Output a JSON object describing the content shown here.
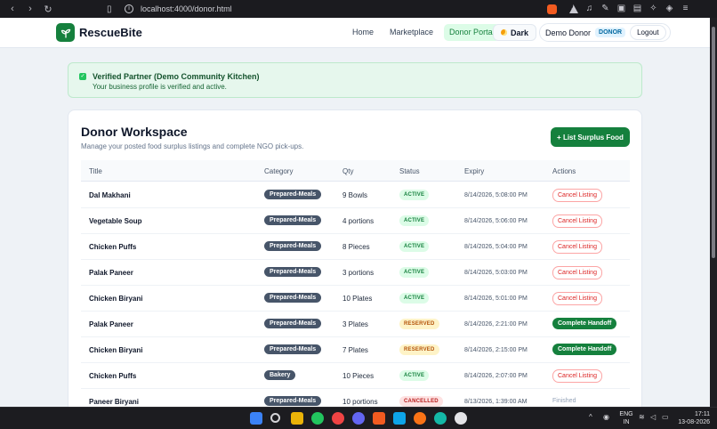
{
  "browser": {
    "url": "localhost:4000/donor.html"
  },
  "header": {
    "brand": "RescueBite",
    "nav": [
      "Home",
      "Marketplace",
      "Donor Portal"
    ],
    "active_nav": "Donor Portal",
    "dark_label": "Dark",
    "user_name": "Demo Donor",
    "user_role": "DONOR",
    "logout_label": "Logout"
  },
  "banner": {
    "title": "Verified Partner (Demo Community Kitchen)",
    "subtitle": "Your business profile is verified and active."
  },
  "workspace": {
    "title": "Donor Workspace",
    "subtitle": "Manage your posted food surplus listings and complete NGO pick-ups.",
    "list_button": "+ List Surplus Food",
    "columns": [
      "Title",
      "Category",
      "Qty",
      "Status",
      "Expiry",
      "Actions"
    ],
    "rows": [
      {
        "title": "Dal Makhani",
        "category": "Prepared-Meals",
        "qty": "9 Bowls",
        "status": "ACTIVE",
        "status_kind": "active",
        "expiry": "8/14/2026, 5:08:00 PM",
        "action": "Cancel Listing",
        "action_kind": "cancel"
      },
      {
        "title": "Vegetable Soup",
        "category": "Prepared-Meals",
        "qty": "4 portions",
        "status": "ACTIVE",
        "status_kind": "active",
        "expiry": "8/14/2026, 5:06:00 PM",
        "action": "Cancel Listing",
        "action_kind": "cancel"
      },
      {
        "title": "Chicken Puffs",
        "category": "Prepared-Meals",
        "qty": "8 Pieces",
        "status": "ACTIVE",
        "status_kind": "active",
        "expiry": "8/14/2026, 5:04:00 PM",
        "action": "Cancel Listing",
        "action_kind": "cancel"
      },
      {
        "title": "Palak Paneer",
        "category": "Prepared-Meals",
        "qty": "3 portions",
        "status": "ACTIVE",
        "status_kind": "active",
        "expiry": "8/14/2026, 5:03:00 PM",
        "action": "Cancel Listing",
        "action_kind": "cancel"
      },
      {
        "title": "Chicken Biryani",
        "category": "Prepared-Meals",
        "qty": "10 Plates",
        "status": "ACTIVE",
        "status_kind": "active",
        "expiry": "8/14/2026, 5:01:00 PM",
        "action": "Cancel Listing",
        "action_kind": "cancel"
      },
      {
        "title": "Palak Paneer",
        "category": "Prepared-Meals",
        "qty": "3 Plates",
        "status": "RESERVED",
        "status_kind": "reserved",
        "expiry": "8/14/2026, 2:21:00 PM",
        "action": "Complete Handoff",
        "action_kind": "complete"
      },
      {
        "title": "Chicken Biryani",
        "category": "Prepared-Meals",
        "qty": "7 Plates",
        "status": "RESERVED",
        "status_kind": "reserved",
        "expiry": "8/14/2026, 2:15:00 PM",
        "action": "Complete Handoff",
        "action_kind": "complete"
      },
      {
        "title": "Chicken Puffs",
        "category": "Bakery",
        "qty": "10 Pieces",
        "status": "ACTIVE",
        "status_kind": "active",
        "expiry": "8/14/2026, 2:07:00 PM",
        "action": "Cancel Listing",
        "action_kind": "cancel"
      },
      {
        "title": "Paneer Biryani",
        "category": "Prepared-Meals",
        "qty": "10 portions",
        "status": "CANCELLED",
        "status_kind": "cancelled",
        "expiry": "8/13/2026, 1:39:00 AM",
        "action": "Finished",
        "action_kind": "finished"
      }
    ]
  },
  "taskbar": {
    "lang_top": "ENG",
    "lang_bottom": "IN",
    "time": "17:11",
    "date": "13-08-2026"
  },
  "colors": {
    "brand_green": "#15803d",
    "badge_active": "#dcfce7",
    "badge_reserved": "#fef3c7",
    "badge_cancelled": "#fee2e2"
  }
}
